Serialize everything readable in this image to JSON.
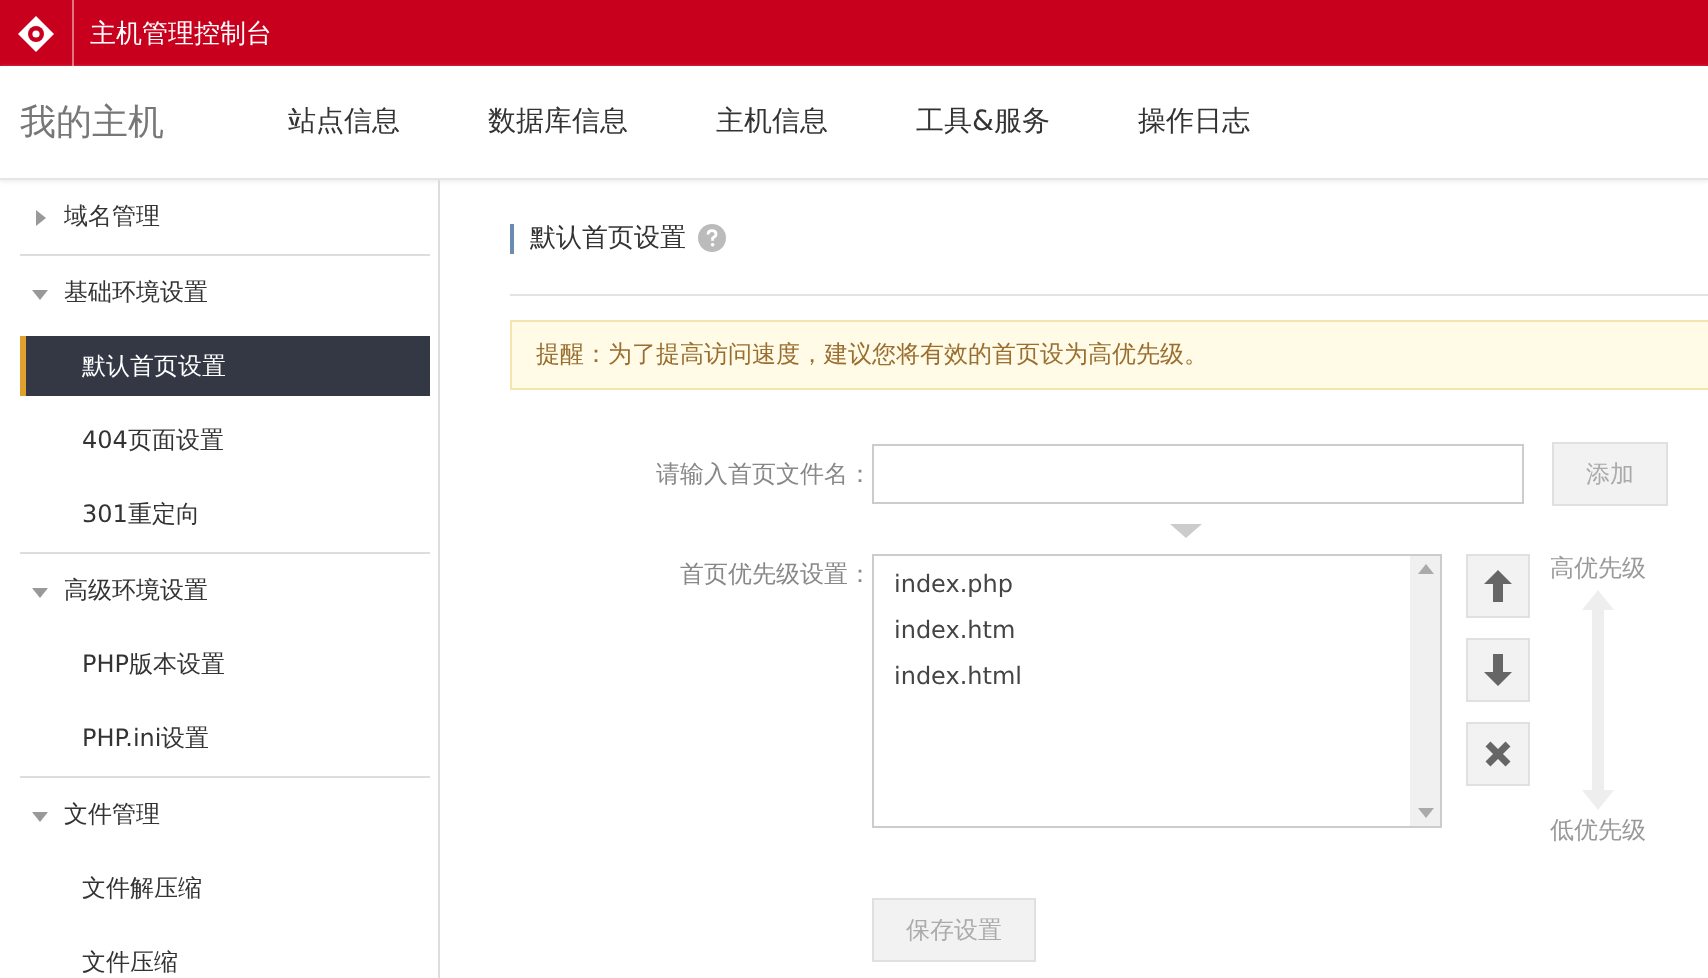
{
  "header": {
    "title": "主机管理控制台"
  },
  "nav": {
    "brand": "我的主机",
    "items": [
      {
        "label": "站点信息",
        "selected": false
      },
      {
        "label": "数据库信息",
        "selected": false
      },
      {
        "label": "主机信息",
        "selected": false
      },
      {
        "label": "工具&服务",
        "selected": false
      },
      {
        "label": "操作日志",
        "selected": false
      }
    ]
  },
  "sidebar": {
    "groups": [
      {
        "label": "域名管理",
        "expanded": false
      },
      {
        "label": "基础环境设置",
        "expanded": true,
        "children": [
          {
            "label": "默认首页设置",
            "selected": true
          },
          {
            "label": "404页面设置",
            "selected": false
          },
          {
            "label": "301重定向",
            "selected": false
          }
        ]
      },
      {
        "label": "高级环境设置",
        "expanded": true,
        "children": [
          {
            "label": "PHP版本设置",
            "selected": false
          },
          {
            "label": "PHP.ini设置",
            "selected": false
          }
        ]
      },
      {
        "label": "文件管理",
        "expanded": true,
        "children": [
          {
            "label": "文件解压缩",
            "selected": false
          },
          {
            "label": "文件压缩",
            "selected": false
          }
        ]
      }
    ]
  },
  "content": {
    "title": "默认首页设置",
    "notice": "提醒：为了提高访问速度，建议您将有效的首页设为高优先级。",
    "filename_label": "请输入首页文件名：",
    "add_button": {
      "label": "添加",
      "disabled": true
    },
    "priority_label": "首页优先级设置：",
    "files": [
      "index.php",
      "index.htm",
      "index.html"
    ],
    "high_label": "高优先级",
    "low_label": "低优先级",
    "save_button": {
      "label": "保存设置",
      "disabled": true
    }
  }
}
